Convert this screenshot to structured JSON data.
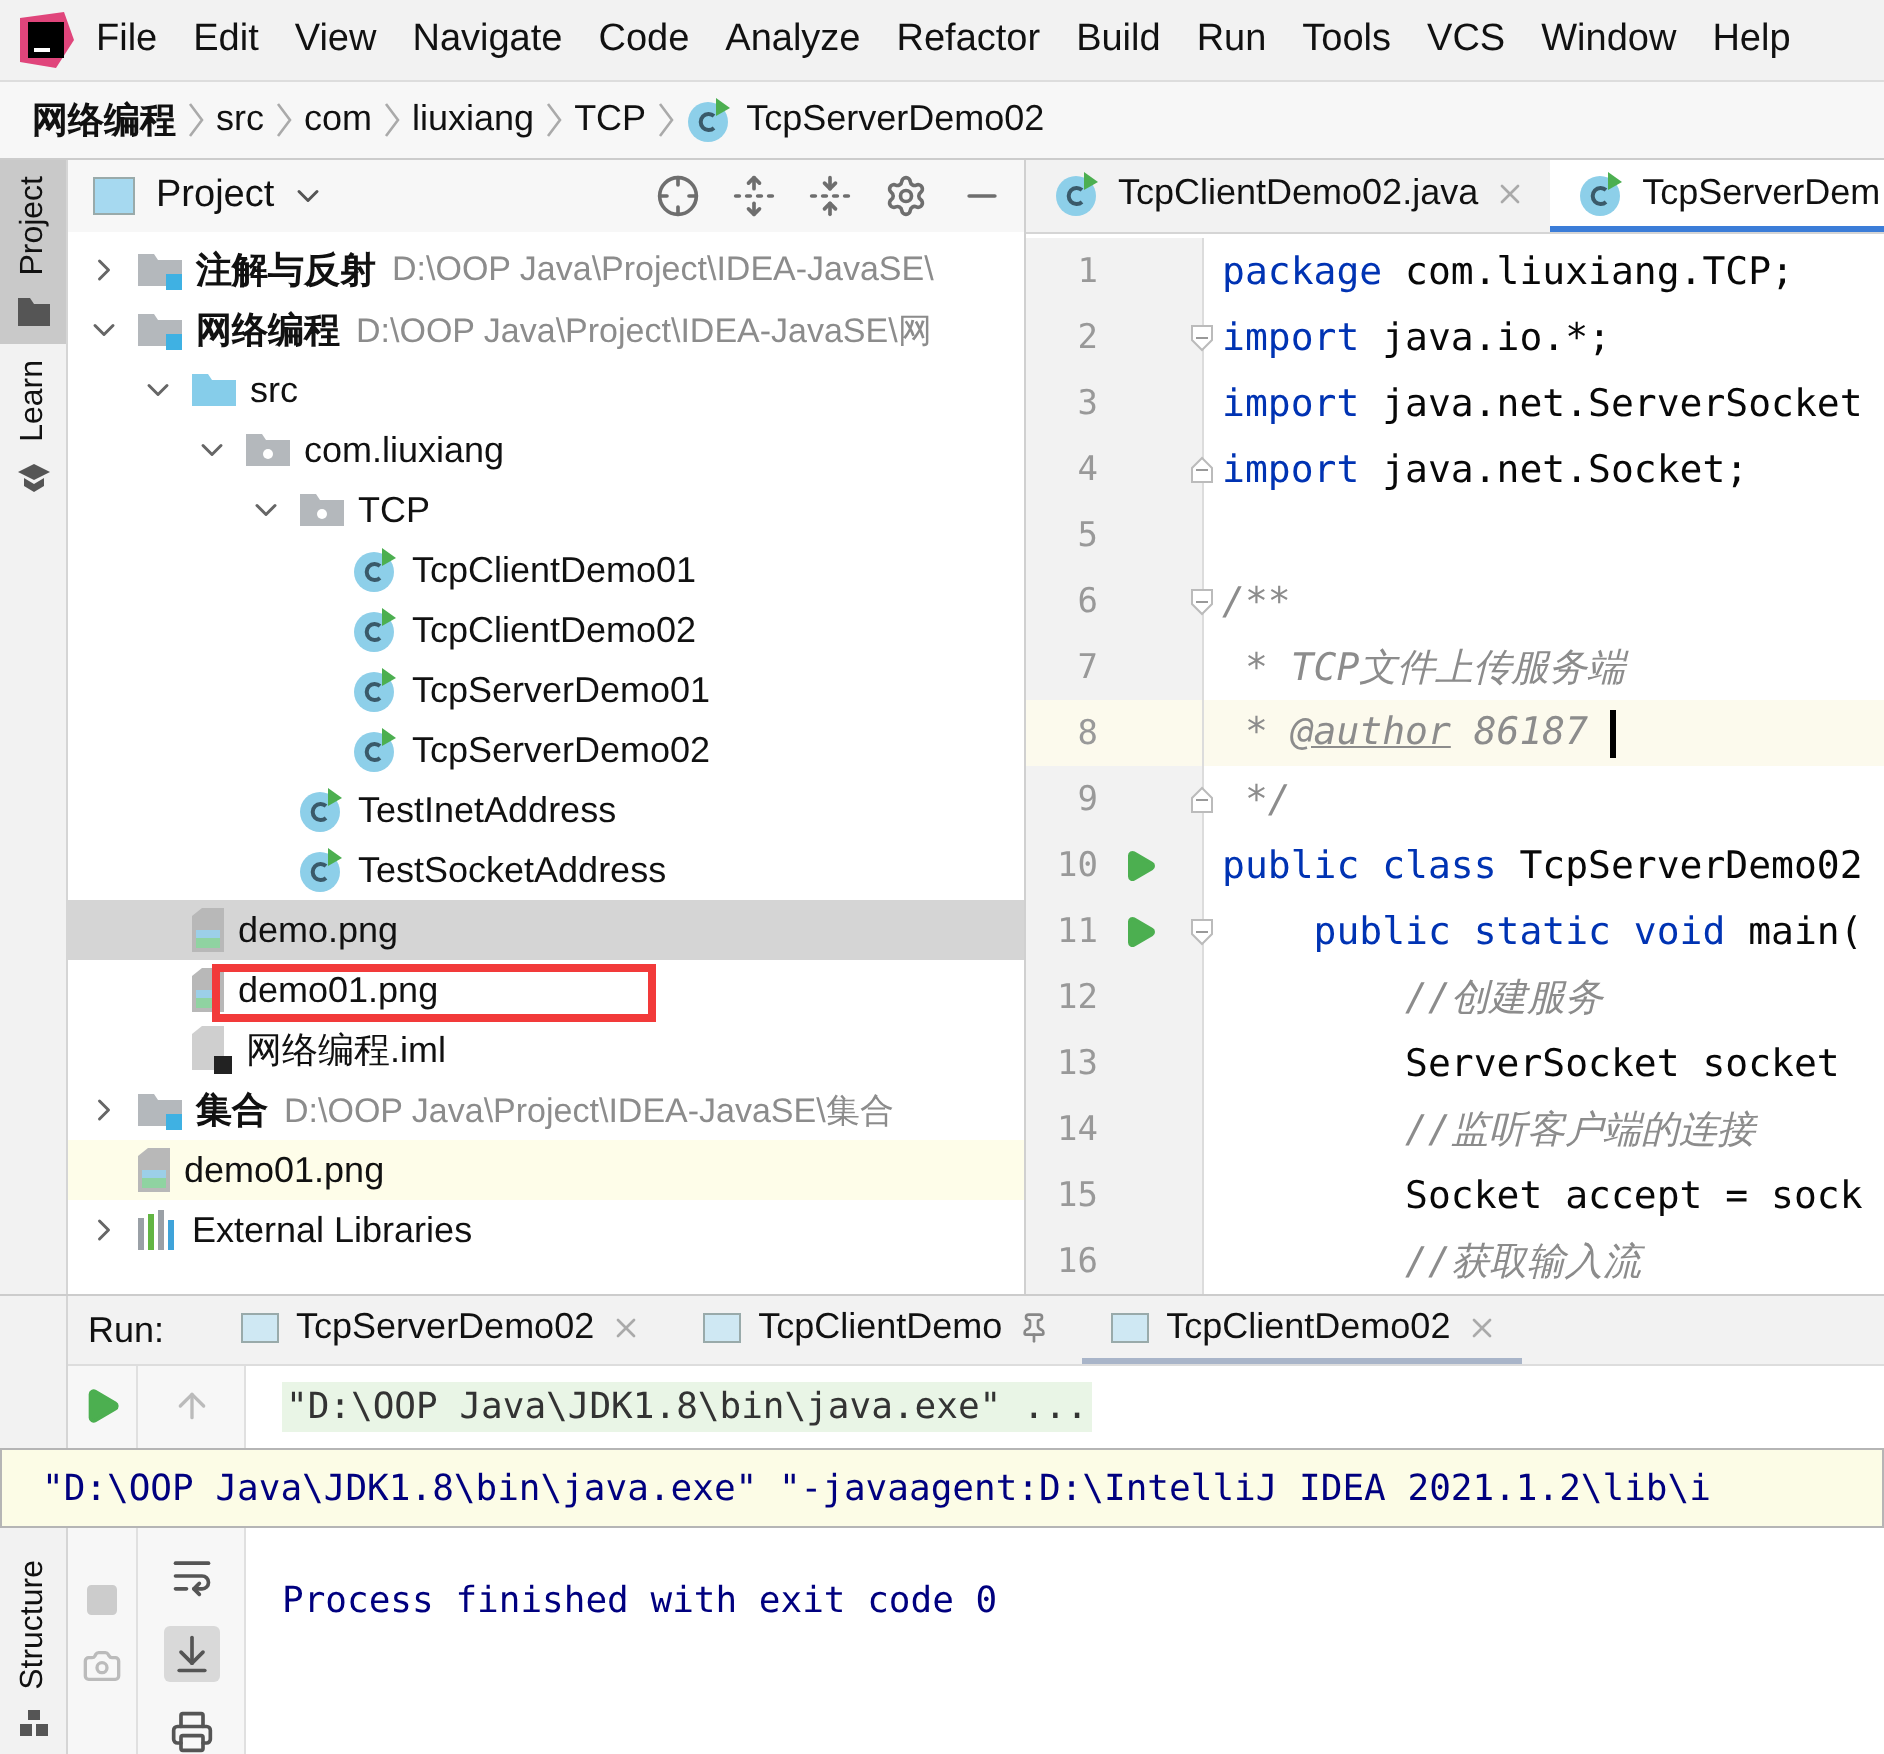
{
  "menu": [
    "File",
    "Edit",
    "View",
    "Navigate",
    "Code",
    "Analyze",
    "Refactor",
    "Build",
    "Run",
    "Tools",
    "VCS",
    "Window",
    "Help"
  ],
  "breadcrumb": [
    {
      "label": "网络编程",
      "kind": "module"
    },
    {
      "label": "src",
      "kind": "dir"
    },
    {
      "label": "com",
      "kind": "dir"
    },
    {
      "label": "liuxiang",
      "kind": "dir"
    },
    {
      "label": "TCP",
      "kind": "dir"
    },
    {
      "label": "TcpServerDemo02",
      "kind": "class"
    }
  ],
  "side_tabs": [
    {
      "label": "Project",
      "selected": true,
      "kind": "folder"
    },
    {
      "label": "Learn",
      "selected": false,
      "kind": "learn"
    }
  ],
  "project": {
    "title": "Project",
    "tree": [
      {
        "label": "注解与反射",
        "kind": "module",
        "path": "D:\\OOP Java\\Project\\IDEA-JavaSE\\",
        "expanded": false,
        "selected": false
      },
      {
        "label": "网络编程",
        "kind": "module",
        "path": "D:\\OOP Java\\Project\\IDEA-JavaSE\\网",
        "expanded": true,
        "selected": false,
        "children": [
          {
            "label": "src",
            "kind": "source",
            "expanded": true,
            "selected": false,
            "children": [
              {
                "label": "com.liuxiang",
                "kind": "package",
                "expanded": true,
                "selected": false,
                "children": [
                  {
                    "label": "TCP",
                    "kind": "package",
                    "expanded": true,
                    "selected": false,
                    "children": [
                      {
                        "label": "TcpClientDemo01",
                        "kind": "class",
                        "selected": false
                      },
                      {
                        "label": "TcpClientDemo02",
                        "kind": "class",
                        "selected": false
                      },
                      {
                        "label": "TcpServerDemo01",
                        "kind": "class",
                        "selected": false
                      },
                      {
                        "label": "TcpServerDemo02",
                        "kind": "class",
                        "selected": false
                      }
                    ]
                  },
                  {
                    "label": "TestInetAddress",
                    "kind": "class",
                    "selected": false
                  },
                  {
                    "label": "TestSocketAddress",
                    "kind": "class",
                    "selected": false
                  }
                ]
              }
            ]
          },
          {
            "label": "demo.png",
            "kind": "image",
            "selected": true
          },
          {
            "label": "demo01.png",
            "kind": "image",
            "selected": false,
            "marked": true
          },
          {
            "label": "网络编程.iml",
            "kind": "iml",
            "selected": false
          }
        ]
      },
      {
        "label": "集合",
        "kind": "module",
        "path": "D:\\OOP Java\\Project\\IDEA-JavaSE\\集合",
        "expanded": false,
        "selected": false
      },
      {
        "label": "demo01.png",
        "kind": "image",
        "selected": false,
        "tinted": true
      },
      {
        "label": "External Libraries",
        "kind": "libraries",
        "expanded": false,
        "selected": false
      }
    ]
  },
  "editor": {
    "tabs": [
      {
        "label": "TcpClientDemo02.java",
        "selected": false
      },
      {
        "label": "TcpServerDem",
        "selected": true
      }
    ],
    "lines": [
      {
        "number": "1",
        "segments": [
          {
            "text": "package",
            "kind": "keyword"
          },
          {
            "text": " com.liuxiang.TCP;",
            "kind": "plain"
          }
        ]
      },
      {
        "number": "2",
        "fold_start": true,
        "segments": [
          {
            "text": "import",
            "kind": "keyword"
          },
          {
            "text": " java.io.*;",
            "kind": "plain"
          }
        ]
      },
      {
        "number": "3",
        "segments": [
          {
            "text": "import",
            "kind": "keyword"
          },
          {
            "text": " java.net.ServerSocket",
            "kind": "plain"
          }
        ]
      },
      {
        "number": "4",
        "fold_end": true,
        "segments": [
          {
            "text": "import",
            "kind": "keyword"
          },
          {
            "text": " java.net.Socket;",
            "kind": "plain"
          }
        ]
      },
      {
        "number": "5"
      },
      {
        "number": "6",
        "fold_start": true,
        "segments": [
          {
            "text": "/**",
            "kind": "comment"
          }
        ]
      },
      {
        "number": "7",
        "segments": [
          {
            "text": " * TCP文件上传服务端",
            "kind": "comment"
          }
        ]
      },
      {
        "number": "8",
        "current": true,
        "segments": [
          {
            "text": " * ",
            "kind": "comment"
          },
          {
            "text": "@author",
            "kind": "doctag"
          },
          {
            "text": " 86187 ",
            "kind": "comment"
          }
        ]
      },
      {
        "number": "9",
        "fold_end": true,
        "segments": [
          {
            "text": " */",
            "kind": "comment"
          }
        ]
      },
      {
        "number": "10",
        "run": true,
        "segments": [
          {
            "text": "public class",
            "kind": "keyword"
          },
          {
            "text": " TcpServerDemo02",
            "kind": "plain"
          }
        ]
      },
      {
        "number": "11",
        "run": true,
        "fold_start": true,
        "segments": [
          {
            "text": "    public static void",
            "kind": "keyword"
          },
          {
            "text": " main(",
            "kind": "plain"
          }
        ]
      },
      {
        "number": "12",
        "segments": [
          {
            "text": "        //创建服务",
            "kind": "comment"
          }
        ]
      },
      {
        "number": "13",
        "segments": [
          {
            "text": "        ServerSocket socket",
            "kind": "plain"
          }
        ]
      },
      {
        "number": "14",
        "segments": [
          {
            "text": "        //监听客户端的连接",
            "kind": "comment"
          }
        ]
      },
      {
        "number": "15",
        "segments": [
          {
            "text": "        Socket accept = sock",
            "kind": "plain"
          }
        ]
      },
      {
        "number": "16",
        "segments": [
          {
            "text": "        //获取输入流",
            "kind": "comment"
          }
        ]
      }
    ]
  },
  "run": {
    "label": "Run:",
    "tabs": [
      {
        "label": "TcpServerDemo02",
        "selected": false,
        "pinned": false
      },
      {
        "label": "TcpClientDemo",
        "selected": false,
        "pinned": true
      },
      {
        "label": "TcpClientDemo02",
        "selected": true,
        "pinned": false
      }
    ],
    "command": "\"D:\\OOP Java\\JDK1.8\\bin\\java.exe\" ...",
    "output": "Process finished with exit code 0",
    "tooltip": "\"D:\\OOP Java\\JDK1.8\\bin\\java.exe\" \"-javaagent:D:\\IntelliJ IDEA 2021.1.2\\lib\\i"
  },
  "bottom_side_tab": {
    "label": "Structure"
  }
}
